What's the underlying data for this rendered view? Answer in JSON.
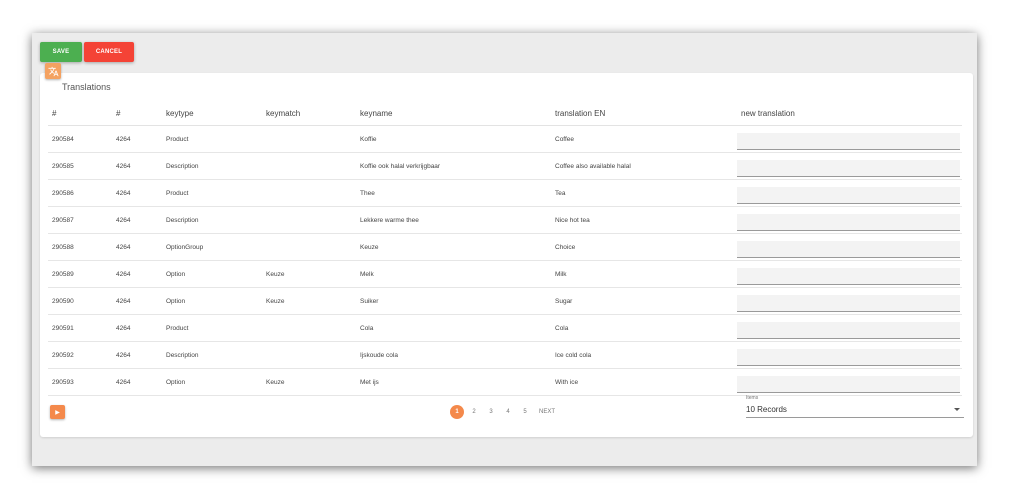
{
  "toolbar": {
    "save_label": "SAVE",
    "cancel_label": "CANCEL"
  },
  "card": {
    "title": "Translations",
    "icon": "translate-icon"
  },
  "table": {
    "headers": [
      "#",
      "#",
      "keytype",
      "keymatch",
      "keyname",
      "translation EN",
      "new translation"
    ],
    "rows": [
      [
        "290584",
        "4264",
        "Product",
        "",
        "Koffie",
        "Coffee"
      ],
      [
        "290585",
        "4264",
        "Description",
        "",
        "Koffie ook halal verkrijgbaar",
        "Coffee also available halal"
      ],
      [
        "290586",
        "4264",
        "Product",
        "",
        "Thee",
        "Tea"
      ],
      [
        "290587",
        "4264",
        "Description",
        "",
        "Lekkere warme thee",
        "Nice hot tea"
      ],
      [
        "290588",
        "4264",
        "OptionGroup",
        "",
        "Keuze",
        "Choice"
      ],
      [
        "290589",
        "4264",
        "Option",
        "Keuze",
        "Melk",
        "Milk"
      ],
      [
        "290590",
        "4264",
        "Option",
        "Keuze",
        "Suiker",
        "Sugar"
      ],
      [
        "290591",
        "4264",
        "Product",
        "",
        "Cola",
        "Cola"
      ],
      [
        "290592",
        "4264",
        "Description",
        "",
        "Ijskoude cola",
        "Ice cold cola"
      ],
      [
        "290593",
        "4264",
        "Option",
        "Keuze",
        "Met ijs",
        "With ice"
      ]
    ]
  },
  "pagination": {
    "pages": [
      "1",
      "2",
      "3",
      "4",
      "5"
    ],
    "active": "1",
    "next_label": "NEXT"
  },
  "items": {
    "label": "Items",
    "value": "10 Records"
  },
  "colors": {
    "save": "#4caf50",
    "cancel": "#f44336",
    "accent": "#f4894b"
  }
}
